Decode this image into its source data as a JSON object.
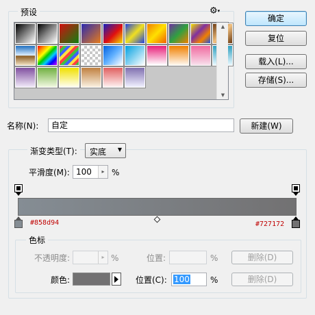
{
  "presets": {
    "title": "预设",
    "gear_icon": "gear-icon",
    "swatches": [
      {
        "name": "black-white",
        "bg": "linear-gradient(135deg,#000 0%,#fff 100%)"
      },
      {
        "name": "black-transparent",
        "bg": "linear-gradient(135deg,#000 0%,#888 50%,#fff 100%)"
      },
      {
        "name": "red-green",
        "bg": "linear-gradient(135deg,#d01010 0%,#108010 100%)"
      },
      {
        "name": "violet-orange",
        "bg": "linear-gradient(135deg,#2b2bb0 0%,#e87c1a 100%)"
      },
      {
        "name": "blue-red-yellow",
        "bg": "linear-gradient(135deg,#1020c0 0%,#e01010 55%,#f0e000 100%)"
      },
      {
        "name": "blue-yellow-blue",
        "bg": "linear-gradient(135deg,#2040e0 0%,#f0e020 50%,#2040e0 100%)"
      },
      {
        "name": "orange-yellow-orange",
        "bg": "linear-gradient(135deg,#f08000 0%,#ffe000 50%,#f06000 100%)"
      },
      {
        "name": "violet-green-orange",
        "bg": "linear-gradient(135deg,#7030a0 0%,#30a040 50%,#f08000 100%)"
      },
      {
        "name": "yellow-violet-orange-blue",
        "bg": "linear-gradient(135deg,#f0e000 0%,#8030a0 40%,#f08000 70%,#2050e0 100%)"
      },
      {
        "name": "copper",
        "bg": "linear-gradient(135deg,#6b3a12 0%,#f0c080 50%,#6b3a12 100%)"
      },
      {
        "name": "chrome",
        "bg": "linear-gradient(180deg,#1f6fc0 0%,#e0f0ff 50%,#8a5a20 52%,#f0e0c0 100%)"
      },
      {
        "name": "spectrum",
        "bg": "linear-gradient(135deg,#f00 0%,#f90 20%,#ff0 35%,#0c0 50%,#0cf 65%,#00f 80%,#c0f 100%)"
      },
      {
        "name": "transparent-rainbow",
        "bg": "repeating-linear-gradient(135deg,#ff4040 0 4px,#40c040 4px 8px,#4060ff 8px 12px,#ffe040 12px 16px)"
      },
      {
        "name": "transparent-stripes",
        "bg": "repeating-conic-gradient(#c8c8c8 0% 25%,#ffffff 0% 50%) 0 0/8px 8px"
      },
      {
        "name": "blue-transparent",
        "bg": "linear-gradient(135deg,#0060e0 0%,#60b0ff 50%,#ffffff 100%)"
      },
      {
        "name": "cyan-white",
        "bg": "linear-gradient(135deg,#00a0e0 0%,#ffffff 100%)"
      },
      {
        "name": "pink-white",
        "bg": "linear-gradient(180deg,#e8207a 0%,#ffffff 100%)"
      },
      {
        "name": "orange-white",
        "bg": "linear-gradient(180deg,#f08000 0%,#fff8f0 100%)"
      },
      {
        "name": "pink-lavender",
        "bg": "linear-gradient(180deg,#f06aa0 0%,#f8e0ec 100%)"
      },
      {
        "name": "teal-white",
        "bg": "linear-gradient(180deg,#30a0c0 0%,#e8f8ff 100%)"
      },
      {
        "name": "violet-white",
        "bg": "linear-gradient(180deg,#8050a0 0%,#f0e8f8 100%)"
      },
      {
        "name": "green-white",
        "bg": "linear-gradient(180deg,#70b040 0%,#f0f8e0 100%)"
      },
      {
        "name": "yellow-white",
        "bg": "linear-gradient(180deg,#f0e000 0%,#fffff0 100%)"
      },
      {
        "name": "tan-white",
        "bg": "linear-gradient(180deg,#c08040 0%,#faf0e0 100%)"
      },
      {
        "name": "salmon-white",
        "bg": "linear-gradient(180deg,#e06060 0%,#fff0f0 100%)"
      },
      {
        "name": "lilac-white",
        "bg": "linear-gradient(180deg,#8070b0 0%,#f0f0ff 100%)"
      }
    ]
  },
  "buttons": {
    "ok": "确定",
    "reset": "复位",
    "load": "载入(L)...",
    "save": "存储(S)...",
    "new": "新建(W)"
  },
  "name_row": {
    "label": "名称(N):",
    "value": "自定"
  },
  "gradient_type": {
    "label": "渐变类型(T):",
    "value": "实底"
  },
  "smoothness": {
    "label": "平滑度(M):",
    "value": "100",
    "unit": "%"
  },
  "gradient_bar": {
    "start_color": "#858d94",
    "end_color": "#727172",
    "start_label": "#858d94",
    "end_label": "#727172"
  },
  "stops": {
    "title": "色标",
    "opacity_label": "不透明度:",
    "opacity_unit": "%",
    "opacity_location_label": "位置:",
    "opacity_location_unit": "%",
    "opacity_delete": "删除(D)",
    "color_label": "颜色:",
    "color_swatch": "#727172",
    "color_location_label": "位置(C):",
    "color_location_value": "100",
    "color_location_unit": "%",
    "color_delete": "删除(D)"
  }
}
